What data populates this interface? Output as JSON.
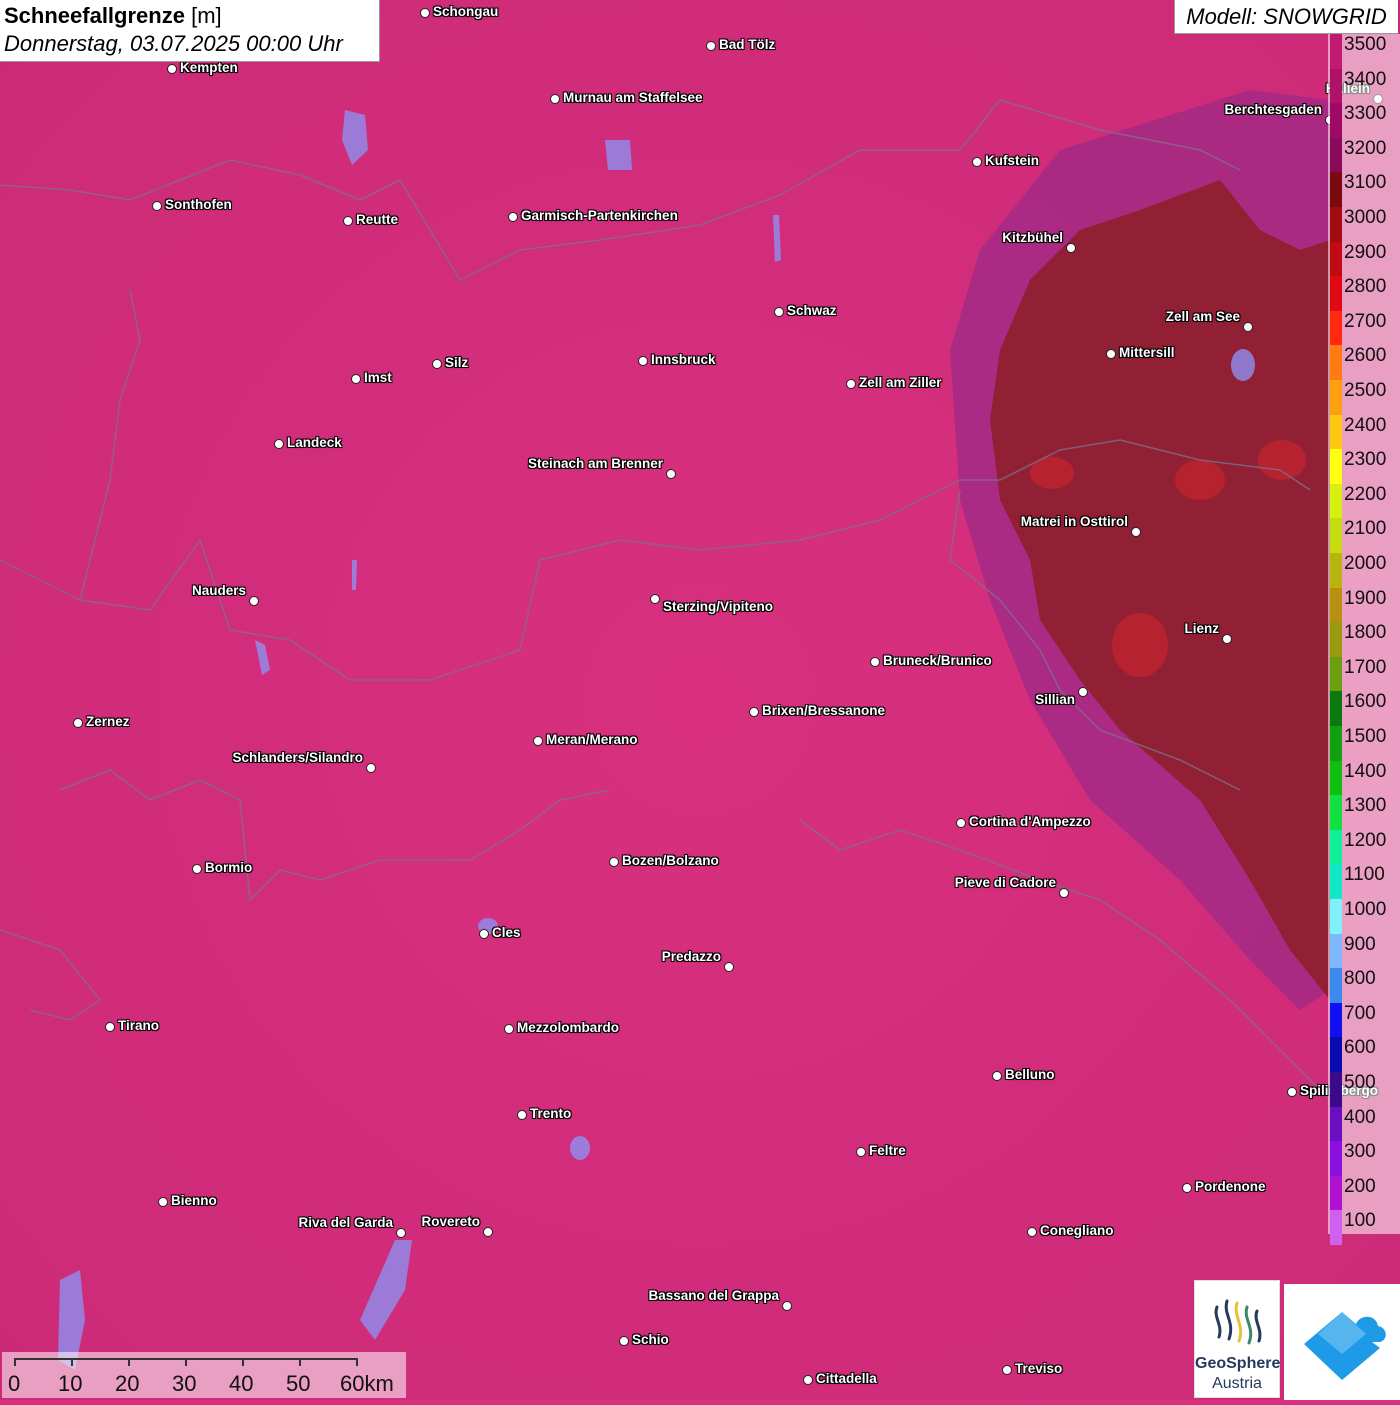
{
  "title": {
    "variable": "Schneefallgrenze",
    "unit": "[m]",
    "datetime": "Donnerstag, 03.07.2025 00:00 Uhr"
  },
  "model_label": "Modell: SNOWGRID",
  "legend": {
    "levels": [
      {
        "label": "3500",
        "color": "#c21a72"
      },
      {
        "label": "3400",
        "color": "#b0126a"
      },
      {
        "label": "3300",
        "color": "#9e0a66"
      },
      {
        "label": "3200",
        "color": "#8a0a5c"
      },
      {
        "label": "3100",
        "color": "#7a0a10"
      },
      {
        "label": "3000",
        "color": "#a30a12"
      },
      {
        "label": "2900",
        "color": "#c20a14"
      },
      {
        "label": "2800",
        "color": "#e00a16"
      },
      {
        "label": "2700",
        "color": "#ff2a10"
      },
      {
        "label": "2600",
        "color": "#ff7a10"
      },
      {
        "label": "2500",
        "color": "#ffa010"
      },
      {
        "label": "2400",
        "color": "#ffc810"
      },
      {
        "label": "2300",
        "color": "#ffff10"
      },
      {
        "label": "2200",
        "color": "#d8f010"
      },
      {
        "label": "2100",
        "color": "#c6dc10"
      },
      {
        "label": "2000",
        "color": "#b8b410"
      },
      {
        "label": "1900",
        "color": "#b89010"
      },
      {
        "label": "1800",
        "color": "#9a9a10"
      },
      {
        "label": "1700",
        "color": "#6aa010"
      },
      {
        "label": "1600",
        "color": "#0a7a10"
      },
      {
        "label": "1500",
        "color": "#10a010"
      },
      {
        "label": "1400",
        "color": "#10c010"
      },
      {
        "label": "1300",
        "color": "#10e040"
      },
      {
        "label": "1200",
        "color": "#10f09a"
      },
      {
        "label": "1100",
        "color": "#10e8c8"
      },
      {
        "label": "1000",
        "color": "#80f0ff"
      },
      {
        "label": "900",
        "color": "#80b8ff"
      },
      {
        "label": "800",
        "color": "#3a8af0"
      },
      {
        "label": "700",
        "color": "#1010f0"
      },
      {
        "label": "600",
        "color": "#0a0ab0"
      },
      {
        "label": "500",
        "color": "#3a0a8a"
      },
      {
        "label": "400",
        "color": "#6a10c0"
      },
      {
        "label": "300",
        "color": "#8a10e0"
      },
      {
        "label": "200",
        "color": "#b010d0"
      },
      {
        "label": "100",
        "color": "#d060f0"
      }
    ]
  },
  "scalebar": {
    "labels": [
      "0",
      "10",
      "20",
      "30",
      "40",
      "50",
      "60km"
    ]
  },
  "logos": {
    "geosphere_line1": "GeoSphere",
    "geosphere_line2": "Austria"
  },
  "cities": [
    {
      "name": "Schongau"
    },
    {
      "name": "Bad Tölz"
    },
    {
      "name": "Kempten"
    },
    {
      "name": "Murnau am Staffelsee"
    },
    {
      "name": "Berchtesgaden"
    },
    {
      "name": "Hallein"
    },
    {
      "name": "Kufstein"
    },
    {
      "name": "Sonthofen"
    },
    {
      "name": "Reutte"
    },
    {
      "name": "Garmisch-Partenkirchen"
    },
    {
      "name": "Kitzbühel"
    },
    {
      "name": "Schwaz"
    },
    {
      "name": "Zell am See"
    },
    {
      "name": "Mittersill"
    },
    {
      "name": "Innsbruck"
    },
    {
      "name": "Silz"
    },
    {
      "name": "Imst"
    },
    {
      "name": "Zell am Ziller"
    },
    {
      "name": "Landeck"
    },
    {
      "name": "Steinach am Brenner"
    },
    {
      "name": "Matrei in Osttirol"
    },
    {
      "name": "Nauders"
    },
    {
      "name": "Sterzing/Vipiteno"
    },
    {
      "name": "Lienz"
    },
    {
      "name": "Bruneck/Brunico"
    },
    {
      "name": "Sillian"
    },
    {
      "name": "Brixen/Bressanone"
    },
    {
      "name": "Zernez"
    },
    {
      "name": "Meran/Merano"
    },
    {
      "name": "Schlanders/Silandro"
    },
    {
      "name": "Cortina d'Ampezzo"
    },
    {
      "name": "Bozen/Bolzano"
    },
    {
      "name": "Bormio"
    },
    {
      "name": "Pieve di Cadore"
    },
    {
      "name": "Cles"
    },
    {
      "name": "Predazzo"
    },
    {
      "name": "Tirano"
    },
    {
      "name": "Mezzolombardo"
    },
    {
      "name": "Belluno"
    },
    {
      "name": "Spilimbergo"
    },
    {
      "name": "Trento"
    },
    {
      "name": "Feltre"
    },
    {
      "name": "Pordenone"
    },
    {
      "name": "Bienno"
    },
    {
      "name": "Riva del Garda"
    },
    {
      "name": "Rovereto"
    },
    {
      "name": "Conegliano"
    },
    {
      "name": "Bassano del Grappa"
    },
    {
      "name": "Schio"
    },
    {
      "name": "Treviso"
    },
    {
      "name": "Cittadella"
    }
  ]
}
